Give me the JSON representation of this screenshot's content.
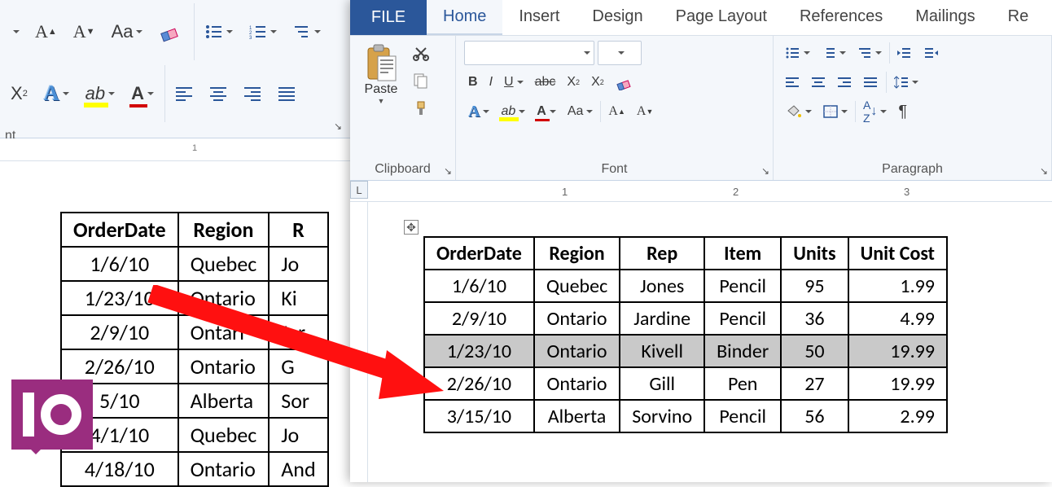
{
  "left": {
    "group_label": "nt",
    "ruler_mark": "1",
    "table": {
      "headers": [
        "OrderDate",
        "Region",
        "R"
      ],
      "rows": [
        [
          "1/6/10",
          "Quebec",
          "Jo"
        ],
        [
          "1/23/10",
          "Ontario",
          "Ki"
        ],
        [
          "2/9/10",
          "Ontari",
          "Jar"
        ],
        [
          "2/26/10",
          "Ontario",
          "G"
        ],
        [
          "5/10",
          "Alberta",
          "Sor"
        ],
        [
          "4/1/10",
          "Quebec",
          "Jo"
        ],
        [
          "4/18/10",
          "Ontario",
          "And"
        ]
      ]
    }
  },
  "right": {
    "tabs": {
      "file": "FILE",
      "home": "Home",
      "insert": "Insert",
      "design": "Design",
      "page_layout": "Page Layout",
      "references": "References",
      "mailings": "Mailings",
      "more": "Re"
    },
    "groups": {
      "clipboard": "Clipboard",
      "font": "Font",
      "paragraph": "Paragraph",
      "paste": "Paste"
    },
    "ruler": {
      "l": "L",
      "m1": "1",
      "m2": "2",
      "m3": "3"
    },
    "table": {
      "headers": [
        "OrderDate",
        "Region",
        "Rep",
        "Item",
        "Units",
        "Unit Cost"
      ],
      "rows": [
        {
          "cells": [
            "1/6/10",
            "Quebec",
            "Jones",
            "Pencil",
            "95",
            "1.99"
          ],
          "selected": false
        },
        {
          "cells": [
            "2/9/10",
            "Ontario",
            "Jardine",
            "Pencil",
            "36",
            "4.99"
          ],
          "selected": false
        },
        {
          "cells": [
            "1/23/10",
            "Ontario",
            "Kivell",
            "Binder",
            "50",
            "19.99"
          ],
          "selected": true
        },
        {
          "cells": [
            "2/26/10",
            "Ontario",
            "Gill",
            "Pen",
            "27",
            "19.99"
          ],
          "selected": false
        },
        {
          "cells": [
            "3/15/10",
            "Alberta",
            "Sorvino",
            "Pencil",
            "56",
            "2.99"
          ],
          "selected": false
        }
      ]
    }
  },
  "logo": {
    "brand": "IO"
  }
}
